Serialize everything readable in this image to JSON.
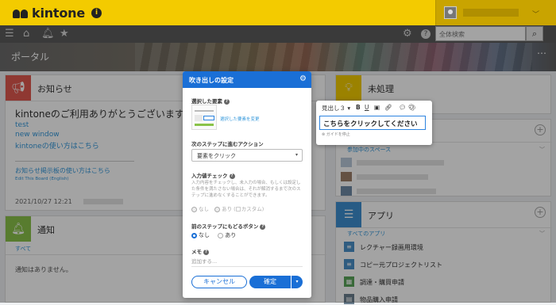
{
  "app": {
    "name": "kintone",
    "info_icon": "i"
  },
  "colors": {
    "brand_yellow": "#f3cb00",
    "nav_gray": "#5b5b5b",
    "primary_blue": "#1a6fd6",
    "link_blue": "#3498db"
  },
  "header": {
    "search_placeholder": "全体検索"
  },
  "portal": {
    "title": "ポータル"
  },
  "news": {
    "title": "お知らせ",
    "headline": "kintoneのご利用ありがとうございます",
    "links": [
      "test",
      "new window",
      "kintoneの使い方はこちら"
    ],
    "help_link": "お知らせ掲示板の使い方はこちら",
    "edit_link": "Edit This Board (English)",
    "timestamp": "2021/10/27 12:21"
  },
  "notifications": {
    "title": "通知",
    "tab_all": "すべて",
    "empty": "通知はありません。"
  },
  "pending": {
    "title": "未処理"
  },
  "spaces": {
    "label": "参加中のスペース"
  },
  "apps": {
    "title": "アプリ",
    "tab_all": "すべてのアプリ",
    "items": [
      "レクチャー録画用環境",
      "コピー元プロジェクトリスト",
      "調達・購買申請",
      "物品購入申請"
    ]
  },
  "modal": {
    "title": "吹き出しの設定",
    "selected_element_label": "選択した要素",
    "change_element_link": "選択した要素を変更",
    "next_action_label": "次のステップに進むアクション",
    "next_action_value": "要素をクリック",
    "input_check_label": "入力値チェック",
    "input_check_desc": "入力内容をチェックし、未入力の場合、もしくは設定した条件を満たさない場合は、それが解消するまで次のステップに進めなくすることができます。",
    "input_check_options": [
      "なし",
      "あり",
      "カスタム"
    ],
    "back_button_label": "前のステップにもどるボタン",
    "back_button_options": [
      "なし",
      "あり"
    ],
    "memo_label": "メモ",
    "memo_placeholder": "追加する...",
    "cancel_label": "キャンセル",
    "confirm_label": "確定"
  },
  "balloon": {
    "heading_select": "見出し３",
    "bold": "B",
    "underline": "U",
    "text": "こちらをクリックしてください",
    "guide_off": "ガイドを停止"
  }
}
